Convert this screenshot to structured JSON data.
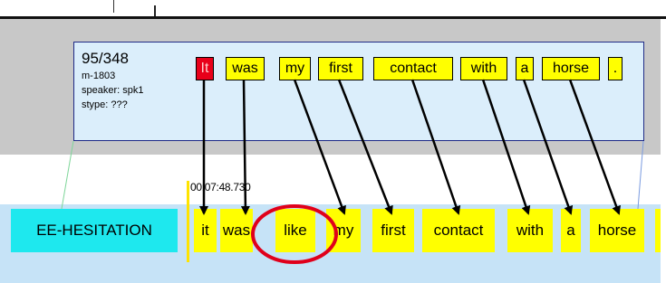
{
  "segment": {
    "number": "95/348",
    "id": "m-1803",
    "speaker": "speaker: spk1",
    "stype": "stype: ???",
    "words": [
      "It",
      "was",
      "my",
      "first",
      "contact",
      "with",
      "a",
      "horse",
      "."
    ]
  },
  "timeline": {
    "timestamp": "00:07:48.730",
    "label": "EE-HESITATION",
    "tokens": [
      "it",
      "was",
      "like",
      "my",
      "first",
      "contact",
      "with",
      "a",
      "horse"
    ]
  },
  "colors": {
    "highlight": "#ffff00",
    "error_token": "#e8001a",
    "annotation_circle": "#e0001b",
    "label_fill": "#1ee8ee",
    "timeline_bg": "#c6e3f7"
  }
}
